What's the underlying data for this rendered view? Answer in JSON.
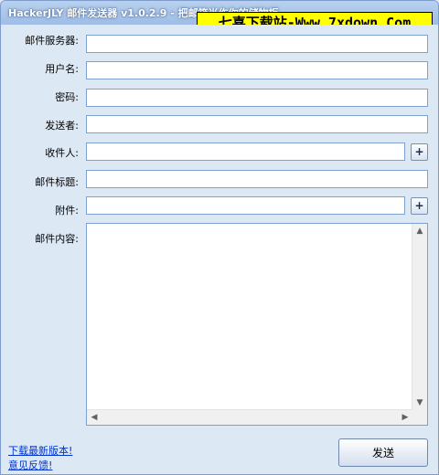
{
  "window": {
    "title": "HackerJLY 邮件发送器 v1.0.2.9 - 把邮箱当作你的储物柜",
    "watermark": "七喜下载站-Www.7xdown.Com"
  },
  "form": {
    "smtp_server_label": "邮件服务器:",
    "smtp_server_value": "",
    "username_label": "用户名:",
    "username_value": "",
    "password_label": "密码:",
    "password_value": "",
    "sender_label": "发送者:",
    "sender_value": "",
    "recipient_label": "收件人:",
    "recipient_value": "",
    "recipient_add": "+",
    "subject_label": "邮件标题:",
    "subject_value": "",
    "attachment_label": "附件:",
    "attachment_value": "",
    "attachment_add": "+",
    "body_label": "邮件内容:",
    "body_value": ""
  },
  "footer": {
    "download_link": "下载最新版本!",
    "feedback_link": "意见反馈!",
    "send_button": "发送"
  }
}
